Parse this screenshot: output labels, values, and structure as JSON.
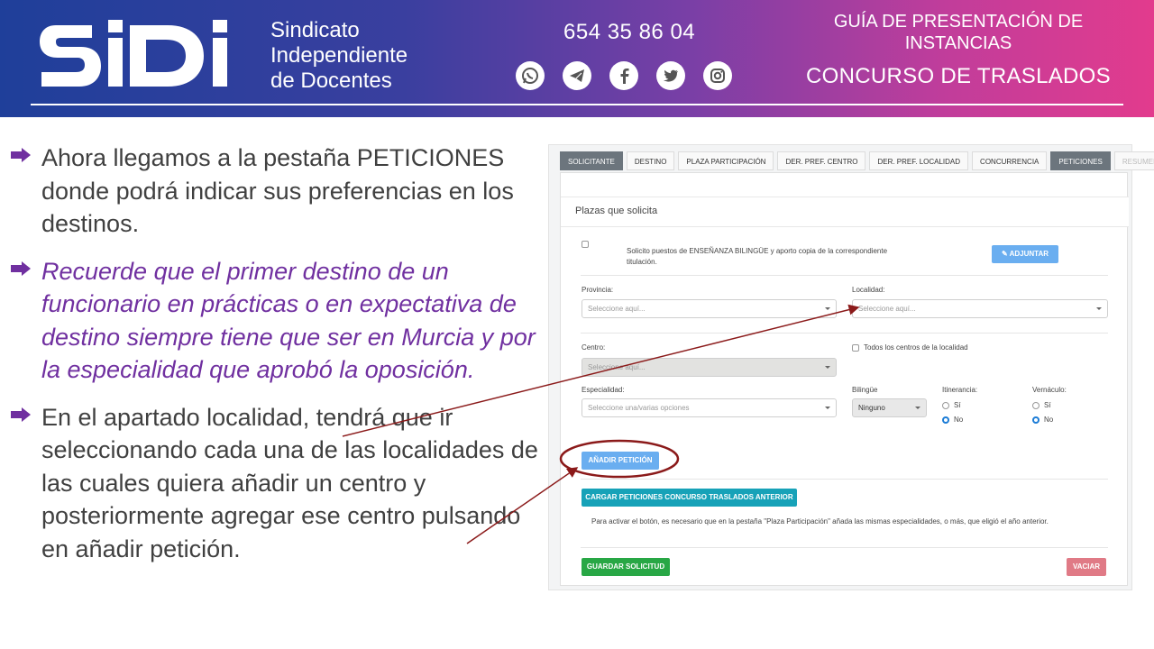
{
  "header": {
    "org_lines": [
      "Sindicato",
      "Independiente",
      "de Docentes"
    ],
    "phone": "654 35 86 04",
    "socials": [
      "whatsapp-icon",
      "telegram-icon",
      "facebook-icon",
      "twitter-icon",
      "instagram-icon"
    ],
    "guide_title_lines": [
      "GUÍA DE PRESENTACIÓN DE",
      "INSTANCIAS"
    ],
    "contest_title": "CONCURSO DE TRASLADOS",
    "logo_text": "SiDi"
  },
  "bullets": [
    {
      "text": "Ahora llegamos a la pestaña PETICIONES donde podrá indicar sus preferencias en los destinos.",
      "style": "normal"
    },
    {
      "text": "Recuerde que el primer destino de un funcionario en prácticas o en expectativa de destino siempre tiene que ser en Murcia y por la especialidad que aprobó la oposición.",
      "style": "italic-purple"
    },
    {
      "text": "En el apartado localidad, tendrá que ir seleccionando cada una de las localidades de las cuales quiera añadir un centro y posteriormente agregar ese centro pulsando en añadir petición.",
      "style": "normal"
    }
  ],
  "form": {
    "tabs": [
      {
        "label": "SOLICITANTE",
        "state": "active"
      },
      {
        "label": "DESTINO",
        "state": "normal"
      },
      {
        "label": "PLAZA PARTICIPACIÓN",
        "state": "normal"
      },
      {
        "label": "DER. PREF. CENTRO",
        "state": "normal"
      },
      {
        "label": "DER. PREF. LOCALIDAD",
        "state": "normal"
      },
      {
        "label": "CONCURRENCIA",
        "state": "normal"
      },
      {
        "label": "PETICIONES",
        "state": "active"
      },
      {
        "label": "RESUMEN",
        "state": "disabled"
      }
    ],
    "panel_title": "Plazas que solicita",
    "bilingual_text_lines": [
      "Solicito puestos de ENSEÑANZA BILINGÜE y aporto copia de la correspondiente",
      "titulación."
    ],
    "attach_button": "ADJUNTAR",
    "provincia_label": "Provincia:",
    "provincia_placeholder": "Seleccione aquí...",
    "localidad_label": "Localidad:",
    "localidad_placeholder": "Seleccione aquí...",
    "centro_label": "Centro:",
    "centro_placeholder": "Seleccione aquí...",
    "todos_centros_label": "Todos los centros de la localidad",
    "especialidad_label": "Especialidad:",
    "especialidad_placeholder": "Seleccione una/varias opciones",
    "bilingue_label": "Bilingüe",
    "bilingue_value": "Ninguno",
    "itinerancia_label": "Itinerancia:",
    "vernaculo_label": "Vernáculo:",
    "yes_label": "Sí",
    "no_label": "No",
    "add_button": "AÑADIR PETICIÓN",
    "load_button": "CARGAR PETICIONES CONCURSO TRASLADOS ANTERIOR",
    "help_text": "Para activar el botón, es necesario que en la pestaña \"Plaza Participación\" añada las mismas especialidades, o más, que eligió el año anterior.",
    "save_button": "GUARDAR SOLICITUD",
    "clear_button": "VACIAR"
  },
  "colors": {
    "banner_start": "#1f3f9a",
    "banner_end": "#e23b8d",
    "body_text": "#404040",
    "emphasis_text": "#7030a0",
    "annotation": "#8b1a1a"
  }
}
